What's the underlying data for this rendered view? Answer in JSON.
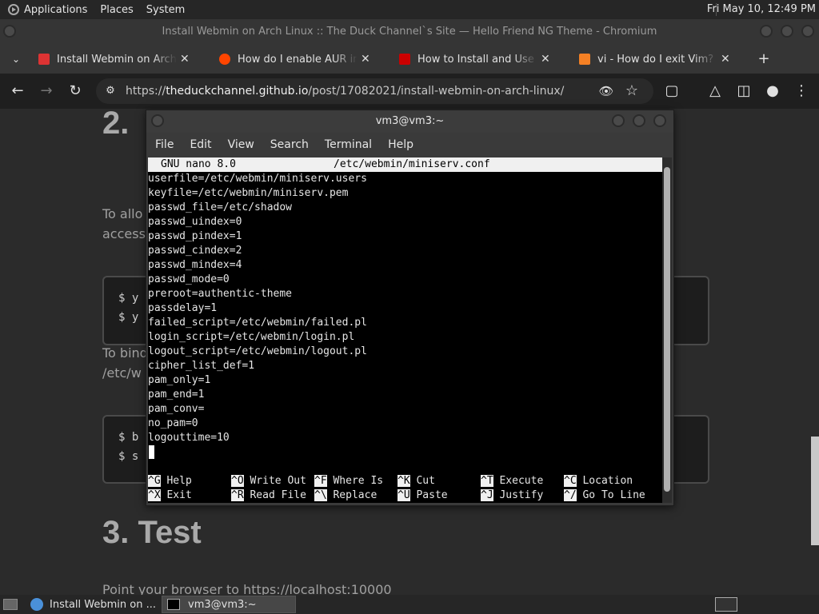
{
  "panel": {
    "menus": [
      "Applications",
      "Places",
      "System"
    ],
    "clock": "Fri May 10, 12:49 PM"
  },
  "browser": {
    "title": "Install Webmin on Arch Linux :: The Duck Channel`s Site — Hello Friend NG Theme - Chromium",
    "tabs": [
      {
        "label": "Install Webmin on Arch Linux",
        "favicon_color": "#d33"
      },
      {
        "label": "How do I enable AUR in pacman",
        "favicon_color": "#ff4500"
      },
      {
        "label": "How to Install and Use GNU",
        "favicon_color": "#c00"
      },
      {
        "label": "vi - How do I exit Vim? - Stack",
        "favicon_color": "#f48024"
      }
    ],
    "url_prefix": "https://",
    "url_host": "theduckchannel.github.io",
    "url_path": "/post/17082021/install-webmin-on-arch-linux/"
  },
  "page": {
    "heading2": "2.",
    "para1_line1": "To allo",
    "para1_line2": "access",
    "code1": [
      "$ y",
      "$ y"
    ],
    "para2_line1": "To bind",
    "para2_line2": "/etc/w",
    "code2": [
      "$ b",
      "$ s"
    ],
    "heading3": "3. Test",
    "para3": "Point your browser to https://localhost:10000"
  },
  "terminal": {
    "title": "vm3@vm3:~",
    "menu": [
      "File",
      "Edit",
      "View",
      "Search",
      "Terminal",
      "Help"
    ],
    "nano_version": "GNU nano 8.0",
    "nano_file": "/etc/webmin/miniserv.conf",
    "lines": [
      "userfile=/etc/webmin/miniserv.users",
      "keyfile=/etc/webmin/miniserv.pem",
      "passwd_file=/etc/shadow",
      "passwd_uindex=0",
      "passwd_pindex=1",
      "passwd_cindex=2",
      "passwd_mindex=4",
      "passwd_mode=0",
      "preroot=authentic-theme",
      "passdelay=1",
      "failed_script=/etc/webmin/failed.pl",
      "login_script=/etc/webmin/login.pl",
      "logout_script=/etc/webmin/logout.pl",
      "cipher_list_def=1",
      "pam_only=1",
      "pam_end=1",
      "pam_conv=",
      "no_pam=0",
      "logouttime=10"
    ],
    "shortcuts_row1": [
      {
        "key": "^G",
        "label": "Help"
      },
      {
        "key": "^O",
        "label": "Write Out"
      },
      {
        "key": "^F",
        "label": "Where Is"
      },
      {
        "key": "^K",
        "label": "Cut"
      },
      {
        "key": "^T",
        "label": "Execute"
      },
      {
        "key": "^C",
        "label": "Location"
      }
    ],
    "shortcuts_row2": [
      {
        "key": "^X",
        "label": "Exit"
      },
      {
        "key": "^R",
        "label": "Read File"
      },
      {
        "key": "^\\",
        "label": "Replace"
      },
      {
        "key": "^U",
        "label": "Paste"
      },
      {
        "key": "^J",
        "label": "Justify"
      },
      {
        "key": "^/",
        "label": "Go To Line"
      }
    ]
  },
  "taskbar": {
    "tasks": [
      {
        "label": "Install Webmin on ...",
        "active": false
      },
      {
        "label": "vm3@vm3:~",
        "active": true
      }
    ]
  }
}
